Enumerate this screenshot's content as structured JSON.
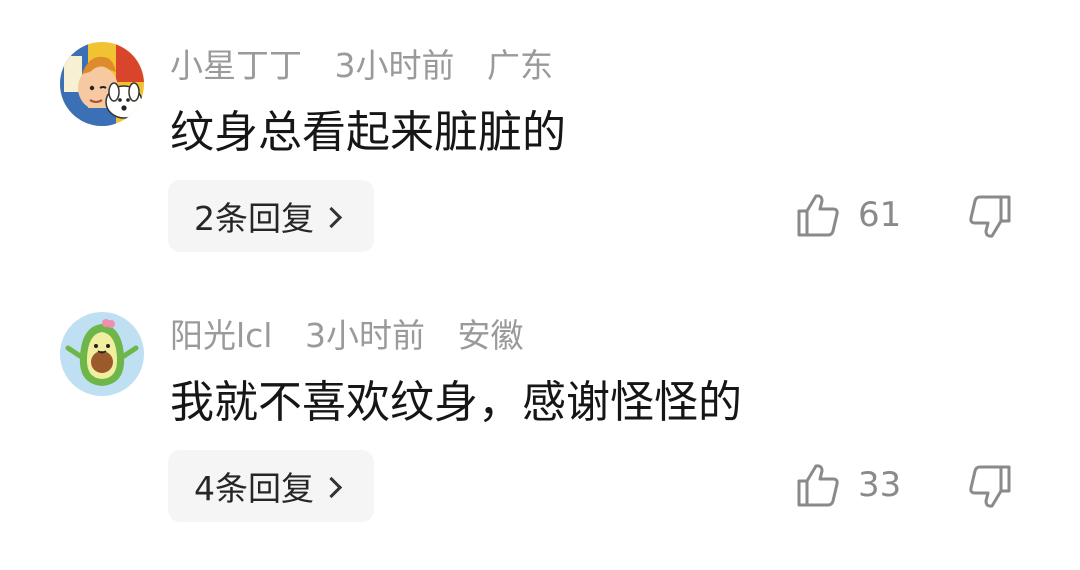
{
  "comments": [
    {
      "user": "小星丁丁",
      "time": "3小时前",
      "location": "广东",
      "text": "纹身总看起来脏脏的",
      "reply_label": "2条回复",
      "likes": "61",
      "avatar_icon": "tintin-cartoon-avatar-icon"
    },
    {
      "user": "阳光lcl",
      "time": "3小时前",
      "location": "安徽",
      "text": "我就不喜欢纹身，感谢怪怪的",
      "reply_label": "4条回复",
      "likes": "33",
      "avatar_icon": "avocado-cartoon-avatar-icon"
    }
  ],
  "colors": {
    "meta_text": "#9a9a9a",
    "body_text": "#161616",
    "reply_bg": "#f5f5f5",
    "icon_stroke": "#8a8a8a"
  }
}
